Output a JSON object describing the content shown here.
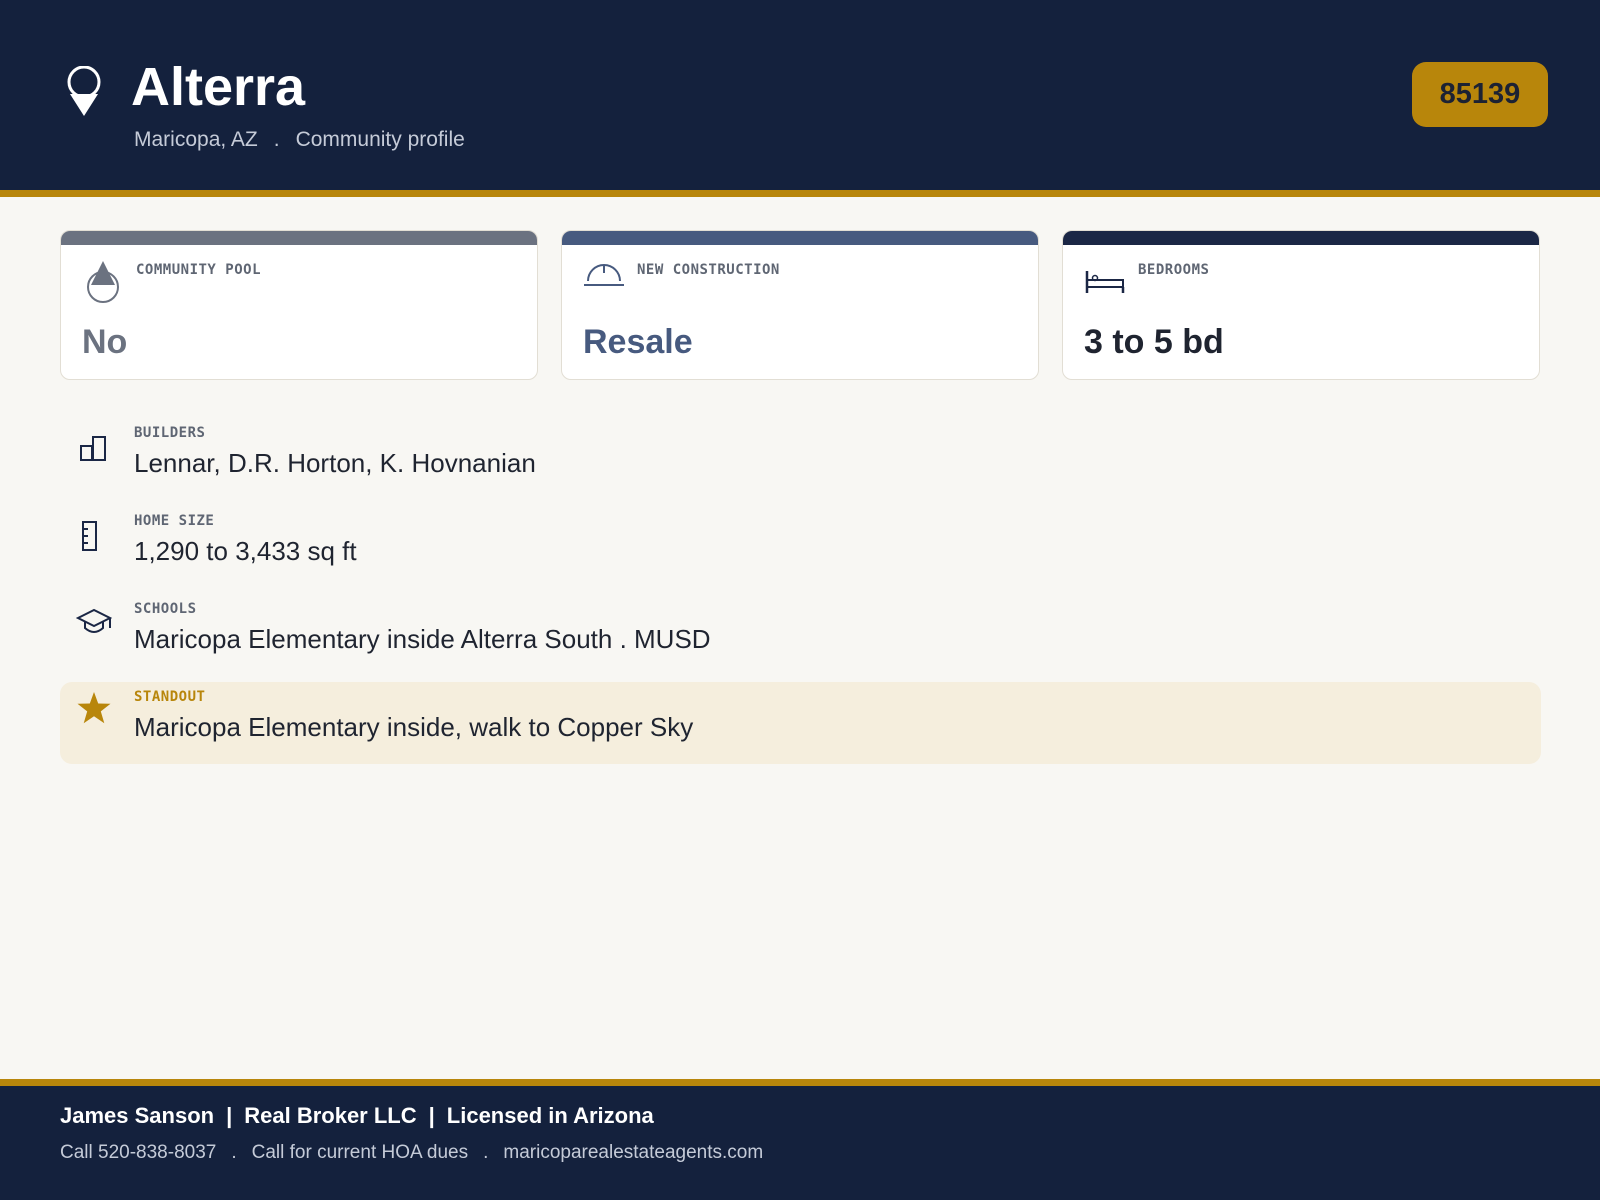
{
  "header": {
    "title": "Alterra",
    "city": "Maricopa, AZ",
    "separator": ".",
    "page_type": "Community profile",
    "zip": "85139",
    "pin_icon": "map-pin-icon"
  },
  "colors": {
    "navy": "#14213d",
    "gold": "#b8860b",
    "slate_gray": "#6b7280",
    "steel_blue": "#475a7f",
    "card_navy": "#1b2745",
    "standout_bg": "#f5eedd"
  },
  "cards": [
    {
      "label": "COMMUNITY POOL",
      "value": "No",
      "icon": "water-drop-icon",
      "accent": "#6b7280"
    },
    {
      "label": "NEW CONSTRUCTION",
      "value": "Resale",
      "icon": "hard-hat-icon",
      "accent": "#475a7f"
    },
    {
      "label": "BEDROOMS",
      "value": "3 to 5 bd",
      "icon": "bed-icon",
      "accent": "#1b2745"
    }
  ],
  "details": [
    {
      "label": "BUILDERS",
      "value": "Lennar, D.R. Horton, K. Hovnanian",
      "icon": "buildings-icon"
    },
    {
      "label": "HOME SIZE",
      "value": "1,290 to 3,433 sq ft",
      "icon": "ruler-icon"
    },
    {
      "label": "SCHOOLS",
      "value": "Maricopa Elementary inside Alterra South . MUSD",
      "icon": "graduation-cap-icon"
    }
  ],
  "standout": {
    "label": "STANDOUT",
    "value": "Maricopa Elementary inside, walk to Copper Sky",
    "icon": "star-icon"
  },
  "footer": {
    "agent": "James Sanson",
    "pipe": "|",
    "brokerage": "Real Broker LLC",
    "license": "Licensed in Arizona",
    "phone": "Call 520-838-8037",
    "separator": ".",
    "hoa_note": "Call for current HOA dues",
    "website": "maricoparealestateagents.com"
  }
}
